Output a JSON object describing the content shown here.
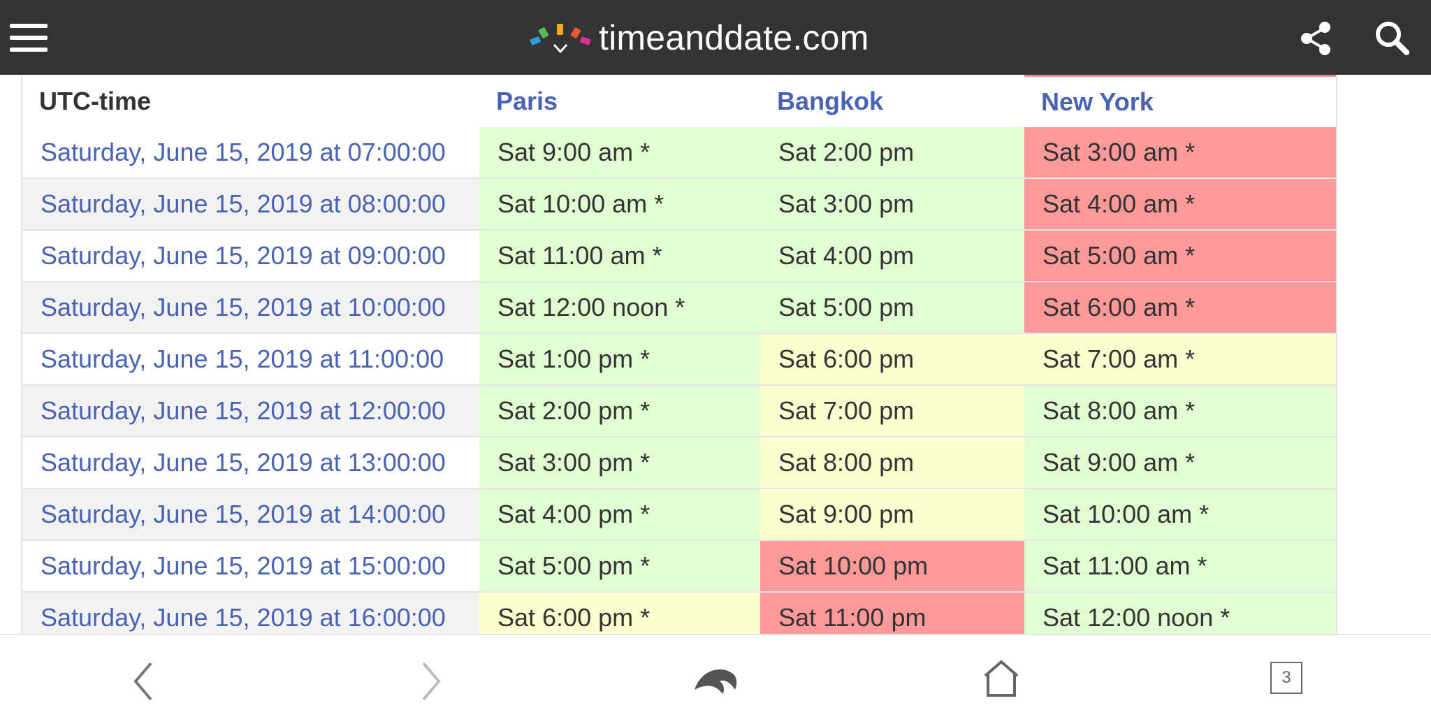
{
  "header": {
    "site_name": "timeanddate.com",
    "menu_icon": "hamburger-menu-icon",
    "share_icon": "share-icon",
    "search_icon": "search-icon",
    "logo_colors": [
      "#5cb85c",
      "#2a9fd6",
      "#f0ad1a",
      "#e8553b",
      "#d9318f"
    ]
  },
  "table": {
    "headers": {
      "utc": "UTC-time",
      "paris": "Paris",
      "bangkok": "Bangkok",
      "new_york": "New York"
    },
    "rows": [
      {
        "utc": "Saturday, June 15, 2019 at 07:00:00",
        "paris": "Sat 9:00 am *",
        "bangkok": "Sat 2:00 pm",
        "new_york": "Sat 3:00 am *"
      },
      {
        "utc": "Saturday, June 15, 2019 at 08:00:00",
        "paris": "Sat 10:00 am *",
        "bangkok": "Sat 3:00 pm",
        "new_york": "Sat 4:00 am *"
      },
      {
        "utc": "Saturday, June 15, 2019 at 09:00:00",
        "paris": "Sat 11:00 am *",
        "bangkok": "Sat 4:00 pm",
        "new_york": "Sat 5:00 am *"
      },
      {
        "utc": "Saturday, June 15, 2019 at 10:00:00",
        "paris": "Sat 12:00 noon *",
        "bangkok": "Sat 5:00 pm",
        "new_york": "Sat 6:00 am *"
      },
      {
        "utc": "Saturday, June 15, 2019 at 11:00:00",
        "paris": "Sat 1:00 pm *",
        "bangkok": "Sat 6:00 pm",
        "new_york": "Sat 7:00 am *"
      },
      {
        "utc": "Saturday, June 15, 2019 at 12:00:00",
        "paris": "Sat 2:00 pm *",
        "bangkok": "Sat 7:00 pm",
        "new_york": "Sat 8:00 am *"
      },
      {
        "utc": "Saturday, June 15, 2019 at 13:00:00",
        "paris": "Sat 3:00 pm *",
        "bangkok": "Sat 8:00 pm",
        "new_york": "Sat 9:00 am *"
      },
      {
        "utc": "Saturday, June 15, 2019 at 14:00:00",
        "paris": "Sat 4:00 pm *",
        "bangkok": "Sat 9:00 pm",
        "new_york": "Sat 10:00 am *"
      },
      {
        "utc": "Saturday, June 15, 2019 at 15:00:00",
        "paris": "Sat 5:00 pm *",
        "bangkok": "Sat 10:00 pm",
        "new_york": "Sat 11:00 am *"
      },
      {
        "utc": "Saturday, June 15, 2019 at 16:00:00",
        "paris": "Sat 6:00 pm *",
        "bangkok": "Sat 11:00 pm",
        "new_york": "Sat 12:00 noon *"
      }
    ],
    "colors": {
      "green": "#e1fdd2",
      "yellow": "#fdfdcf",
      "red": "#fe9999",
      "link": "#4a62b3"
    }
  },
  "bottom_nav": {
    "back_icon": "back-arrow-icon",
    "forward_icon": "forward-arrow-icon",
    "dolphin_icon": "dolphin-icon",
    "home_icon": "home-icon",
    "tab_count": "3"
  }
}
